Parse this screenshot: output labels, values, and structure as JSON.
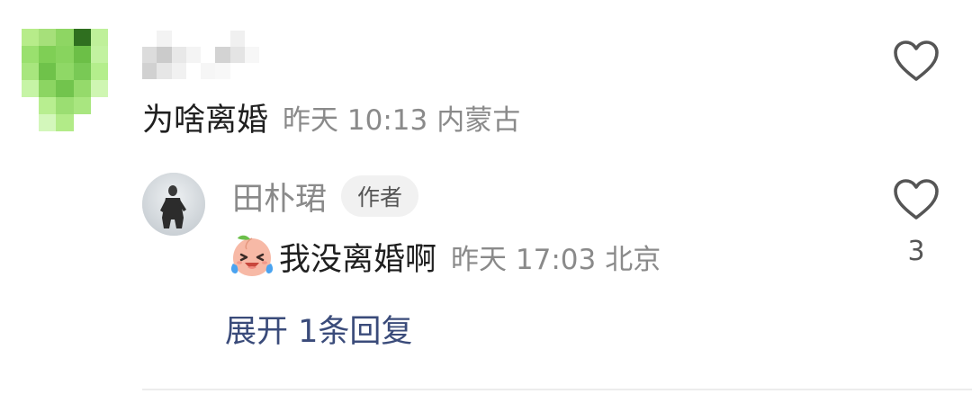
{
  "comment": {
    "avatar_icon": "pixelated-avatar-icon",
    "username_icon": "blurred-username-icon",
    "text": "为啥离婚",
    "time": "昨天 10:13",
    "location": "内蒙古",
    "like_icon": "heart-outline-icon"
  },
  "reply": {
    "avatar_icon": "avatar-photo-icon",
    "username": "田朴珺",
    "badge": "作者",
    "emoji_icon": "crying-laughing-face-icon",
    "text": "我没离婚啊",
    "time": "昨天 17:03",
    "location": "北京",
    "like_icon": "heart-outline-icon",
    "like_count": "3"
  },
  "expand": {
    "label": "展开 1条回复"
  },
  "colors": {
    "accent_link": "#3a4b7a",
    "meta_gray": "#8a8a8a",
    "badge_bg": "#f1f1f1"
  }
}
